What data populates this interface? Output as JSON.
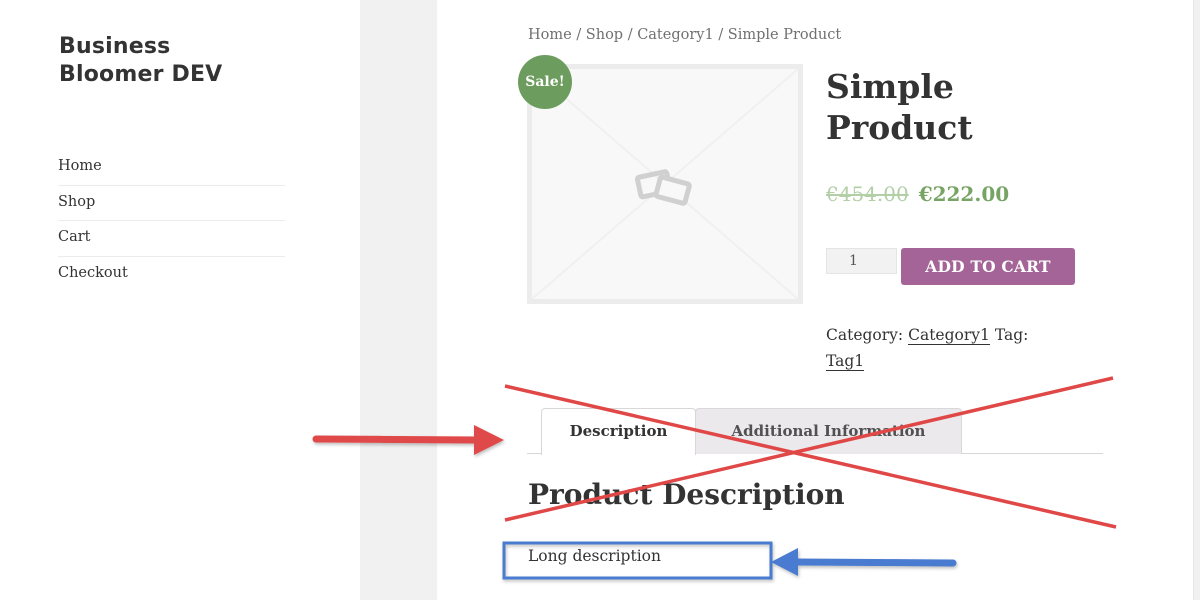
{
  "site": {
    "title_line1": "Business",
    "title_line2": "Bloomer DEV"
  },
  "menu": {
    "items": [
      {
        "label": "Home"
      },
      {
        "label": "Shop"
      },
      {
        "label": "Cart"
      },
      {
        "label": "Checkout"
      }
    ]
  },
  "breadcrumb": {
    "text": "Home / Shop / Category1 / Simple Product"
  },
  "product": {
    "sale_badge": "Sale!",
    "title_line1": "Simple",
    "title_line2": "Product",
    "regular_price": "€454.00",
    "sale_price": "€222.00",
    "quantity": "1",
    "add_to_cart_label": "ADD TO CART",
    "category_label": "Category:",
    "category_value": "Category1",
    "tag_label": "Tag:",
    "tag_value": "Tag1",
    "image_icon": "image-placeholder-icon"
  },
  "tabs": [
    {
      "label": "Description",
      "active": true
    },
    {
      "label": "Additional Information",
      "active": false
    }
  ],
  "description": {
    "heading": "Product Description",
    "body": "Long description"
  },
  "colors": {
    "sale_badge": "#6c9d5e",
    "price": "#77a464",
    "old_price": "#b2cfa6",
    "button": "#a46497",
    "annotation_red": "#e04848",
    "annotation_blue": "#4a7bd0"
  },
  "annotations": {
    "red_cross": "cross-out-mark",
    "red_arrow": "arrow-pointing-right",
    "blue_arrow": "arrow-pointing-left",
    "blue_box": "highlight-box"
  }
}
